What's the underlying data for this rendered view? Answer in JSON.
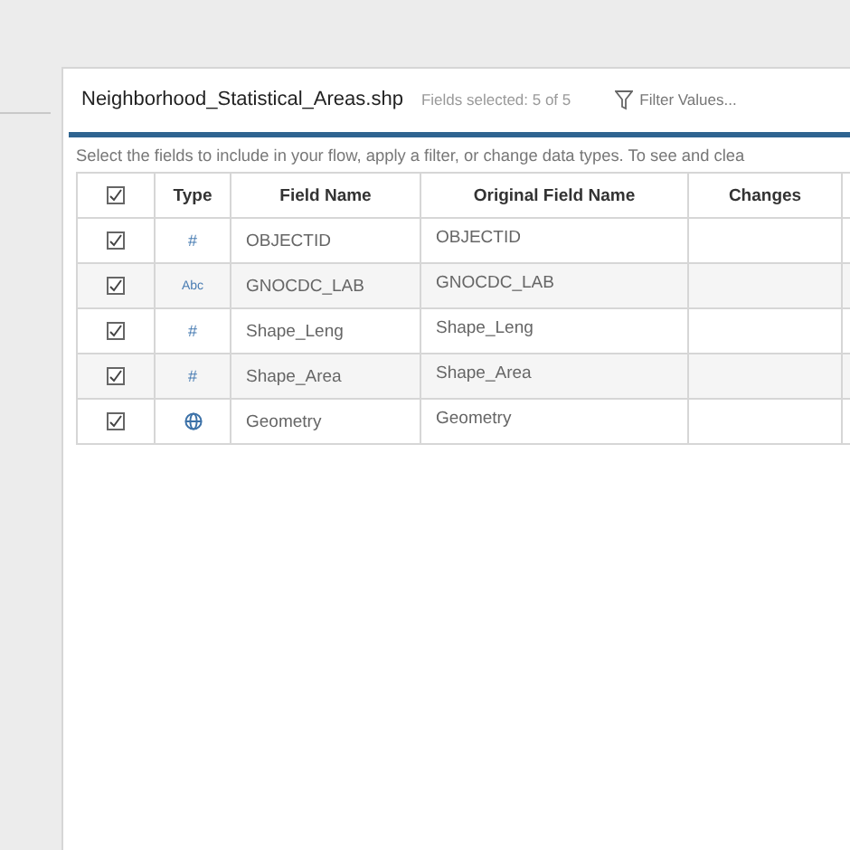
{
  "panel": {
    "title": "Neighborhood_Statistical_Areas.shp",
    "fields_selected": "Fields selected: 5 of 5",
    "filter_button": "Filter Values..."
  },
  "description": "Select the fields to include in your flow, apply a filter, or change data types. To see and clea",
  "table": {
    "all_checked": true,
    "columns": [
      "Type",
      "Field Name",
      "Original Field Name",
      "Changes"
    ],
    "rows": [
      {
        "checked": true,
        "type": {
          "kind": "symbol",
          "symbol": "#"
        },
        "field_name": "OBJECTID",
        "original_field_name": "OBJECTID"
      },
      {
        "checked": true,
        "type": {
          "kind": "symbol",
          "symbol": "Abc"
        },
        "field_name": "GNOCDC_LAB",
        "original_field_name": "GNOCDC_LAB"
      },
      {
        "checked": true,
        "type": {
          "kind": "symbol",
          "symbol": "#"
        },
        "field_name": "Shape_Leng",
        "original_field_name": "Shape_Leng"
      },
      {
        "checked": true,
        "type": {
          "kind": "symbol",
          "symbol": "#"
        },
        "field_name": "Shape_Area",
        "original_field_name": "Shape_Area"
      },
      {
        "checked": true,
        "type": {
          "kind": "globe"
        },
        "field_name": "Geometry",
        "original_field_name": "Geometry"
      }
    ]
  }
}
